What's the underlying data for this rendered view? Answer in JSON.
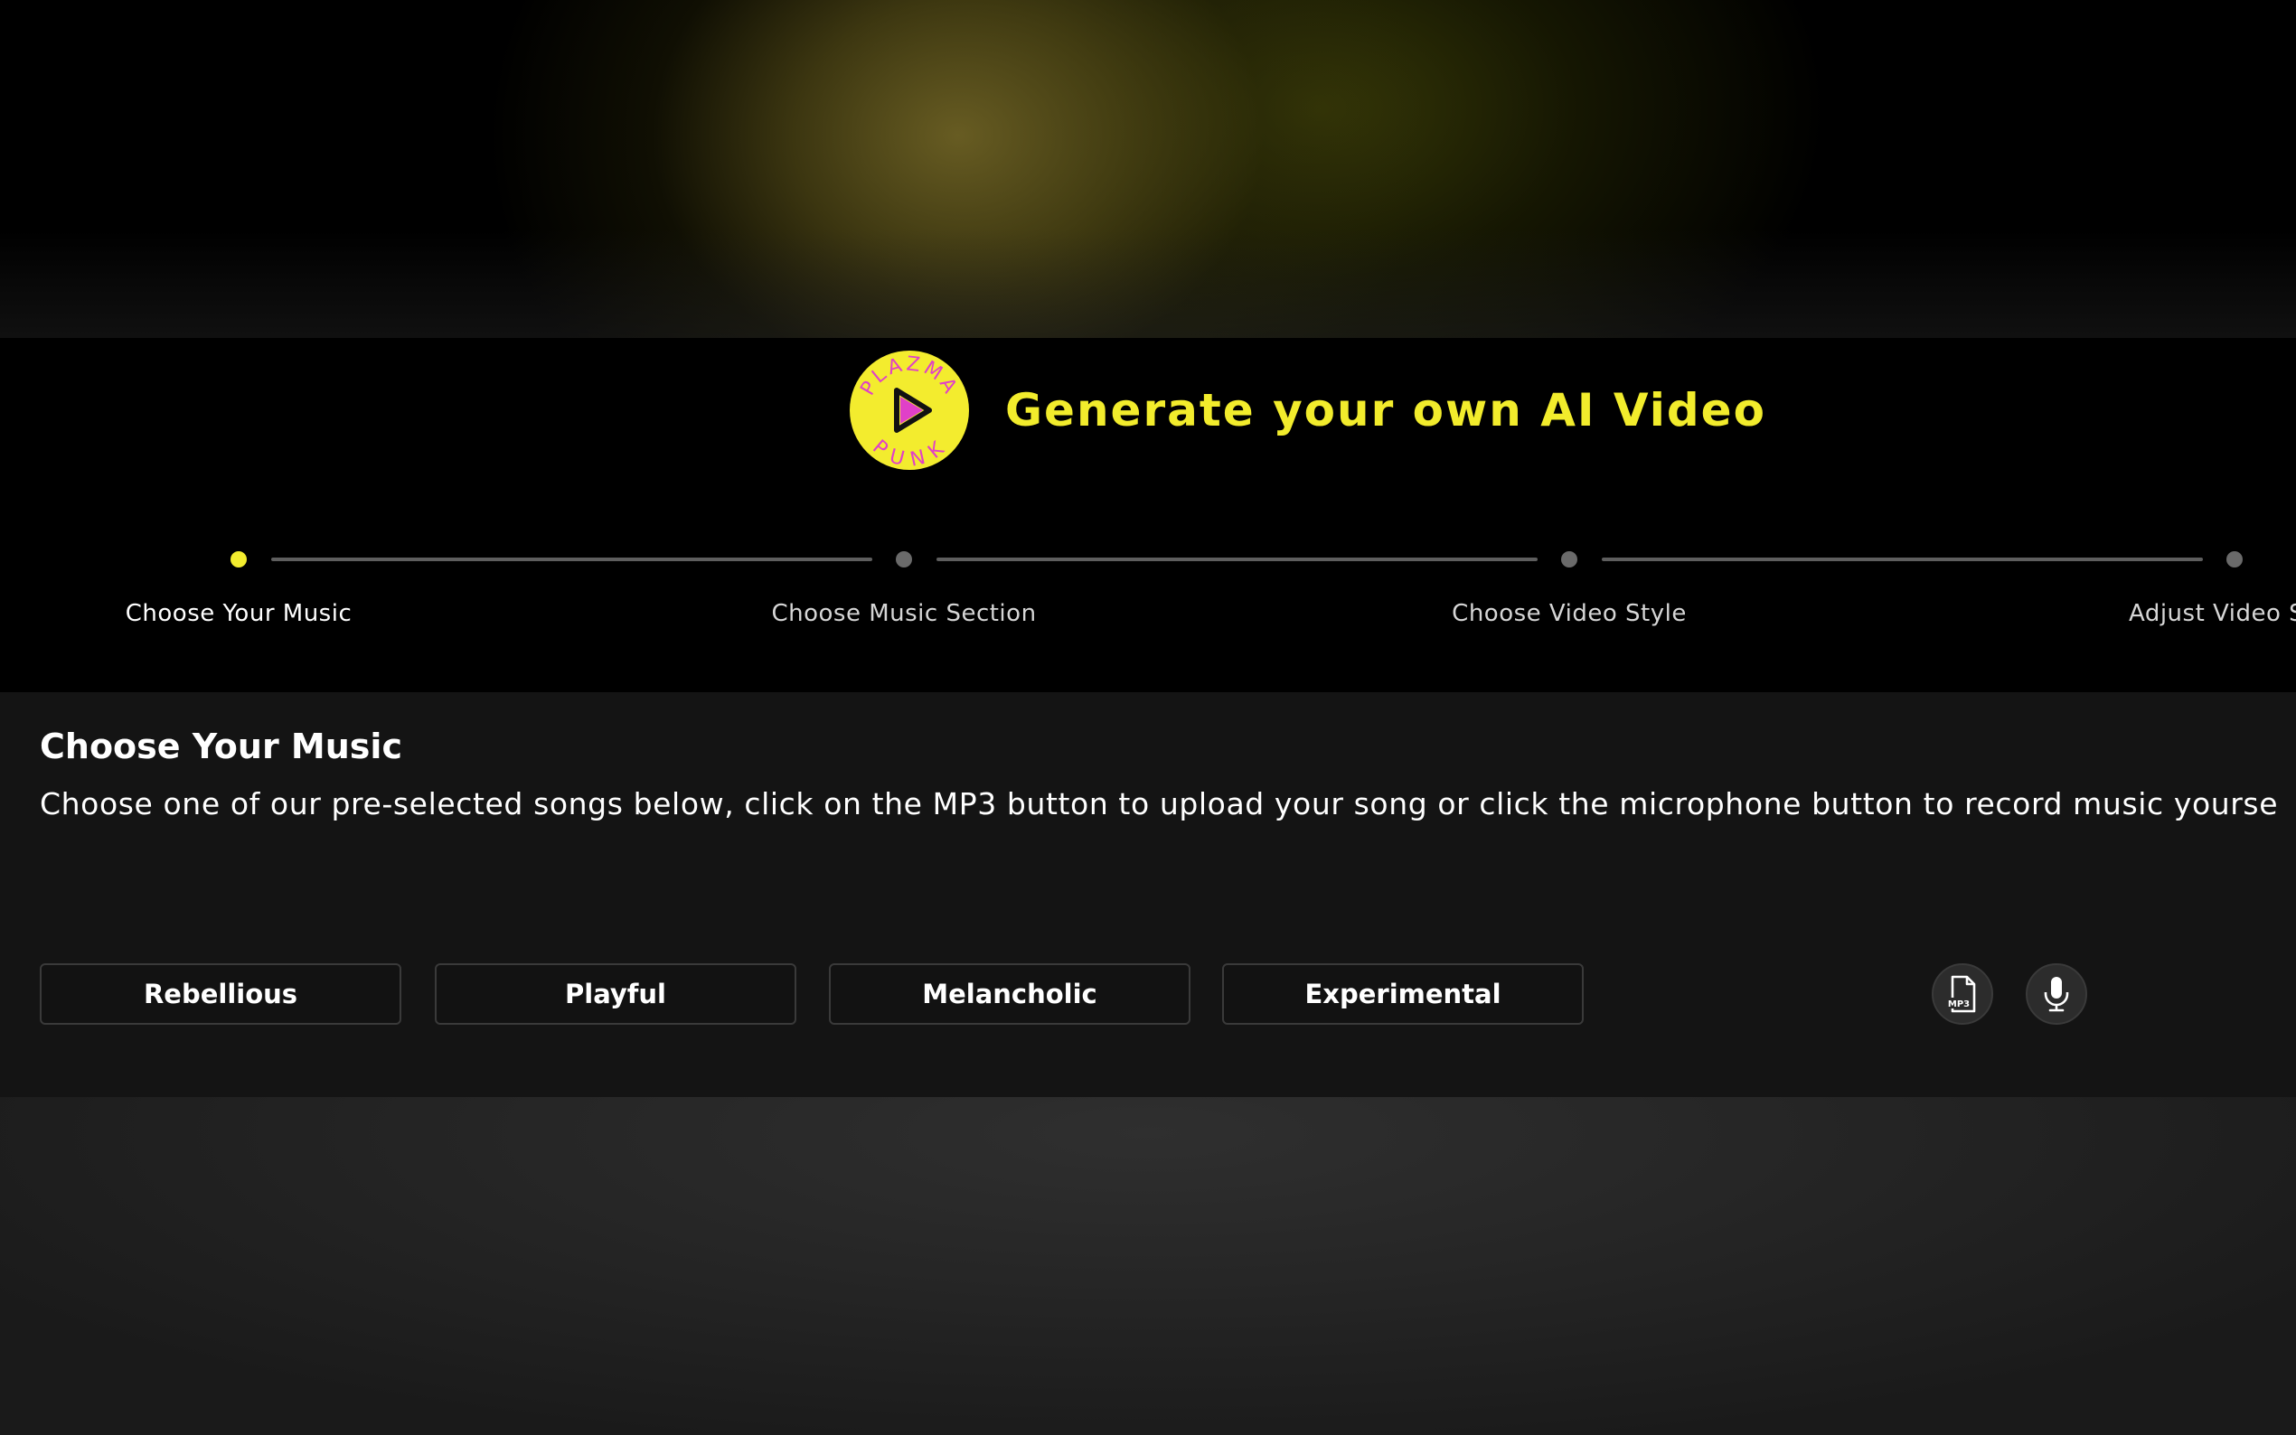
{
  "header": {
    "title": "Generate your own AI Video",
    "logo_text_top": "PLAZMA",
    "logo_text_bottom": "PUNK",
    "logo_icon": "play-icon"
  },
  "stepper": {
    "steps": [
      {
        "label": "Choose Your Music",
        "active": true
      },
      {
        "label": "Choose Music Section",
        "active": false
      },
      {
        "label": "Choose Video Style",
        "active": false
      },
      {
        "label": "Adjust Video S",
        "active": false
      }
    ]
  },
  "panel": {
    "title": "Choose Your Music",
    "description": "Choose one of our pre-selected songs below, click on the MP3 button to upload your song or click the microphone button to record music yourse",
    "moods": [
      "Rebellious",
      "Playful",
      "Melancholic",
      "Experimental"
    ],
    "upload_icon": "mp3-file-icon",
    "upload_icon_text": "MP3",
    "record_icon": "microphone-icon"
  },
  "colors": {
    "accent": "#f3ec2e",
    "logo_text": "#e040c8",
    "background": "#000000",
    "panel": "#141414"
  }
}
